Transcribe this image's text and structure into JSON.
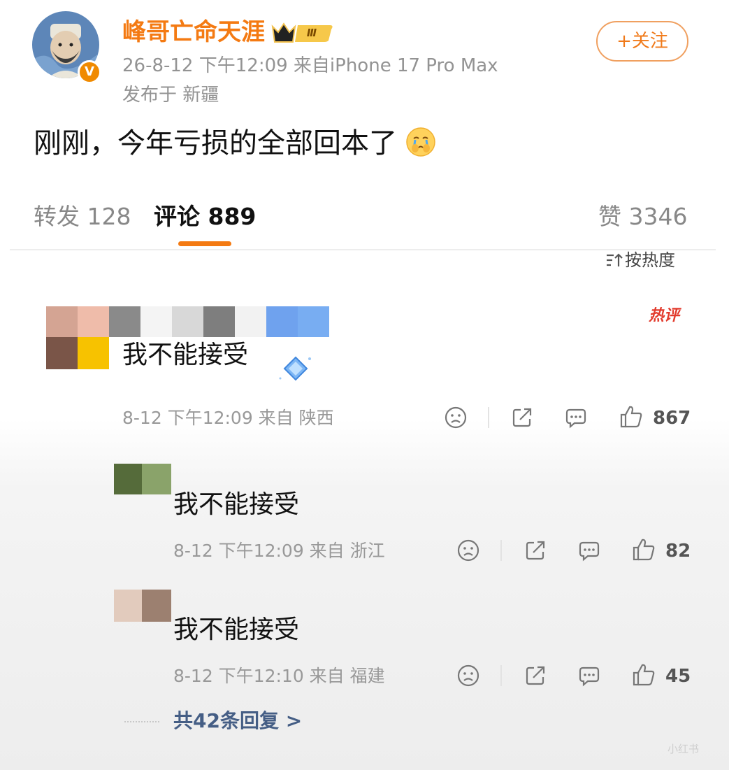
{
  "post": {
    "author_name": "峰哥亡命天涯",
    "vip_level": "Ⅲ",
    "verified_mark": "V",
    "meta": "26-8-12 下午12:09  来自iPhone 17 Pro Max",
    "location": "发布于 新疆",
    "follow_label": "+关注",
    "text": "刚刚，今年亏损的全部回本了"
  },
  "tabs": {
    "repost": "转发 128",
    "comments": "评论 889",
    "likes": "赞 3346"
  },
  "sort": {
    "label": "按热度"
  },
  "comment": {
    "hot_tag": "热评",
    "text": "我不能接受",
    "meta": "8-12 下午12:09 来自 陕西",
    "like_count": "867"
  },
  "replies": [
    {
      "text": "我不能接受",
      "meta": "8-12 下午12:09 来自 浙江",
      "like_count": "82"
    },
    {
      "text": "我不能接受",
      "meta": "8-12 下午12:10 来自 福建",
      "like_count": "45"
    }
  ],
  "view_all_replies": "共42条回复 >",
  "watermark": "小红书",
  "colors": {
    "brand_orange": "#f47a12",
    "hot_red": "#e23b2d",
    "link_blue": "#455e85",
    "meta_gray": "#999999"
  },
  "icons": [
    "dislike-icon",
    "share-icon",
    "comment-icon",
    "like-icon",
    "sort-icon",
    "crying-emoji-icon",
    "diamond-icon"
  ]
}
